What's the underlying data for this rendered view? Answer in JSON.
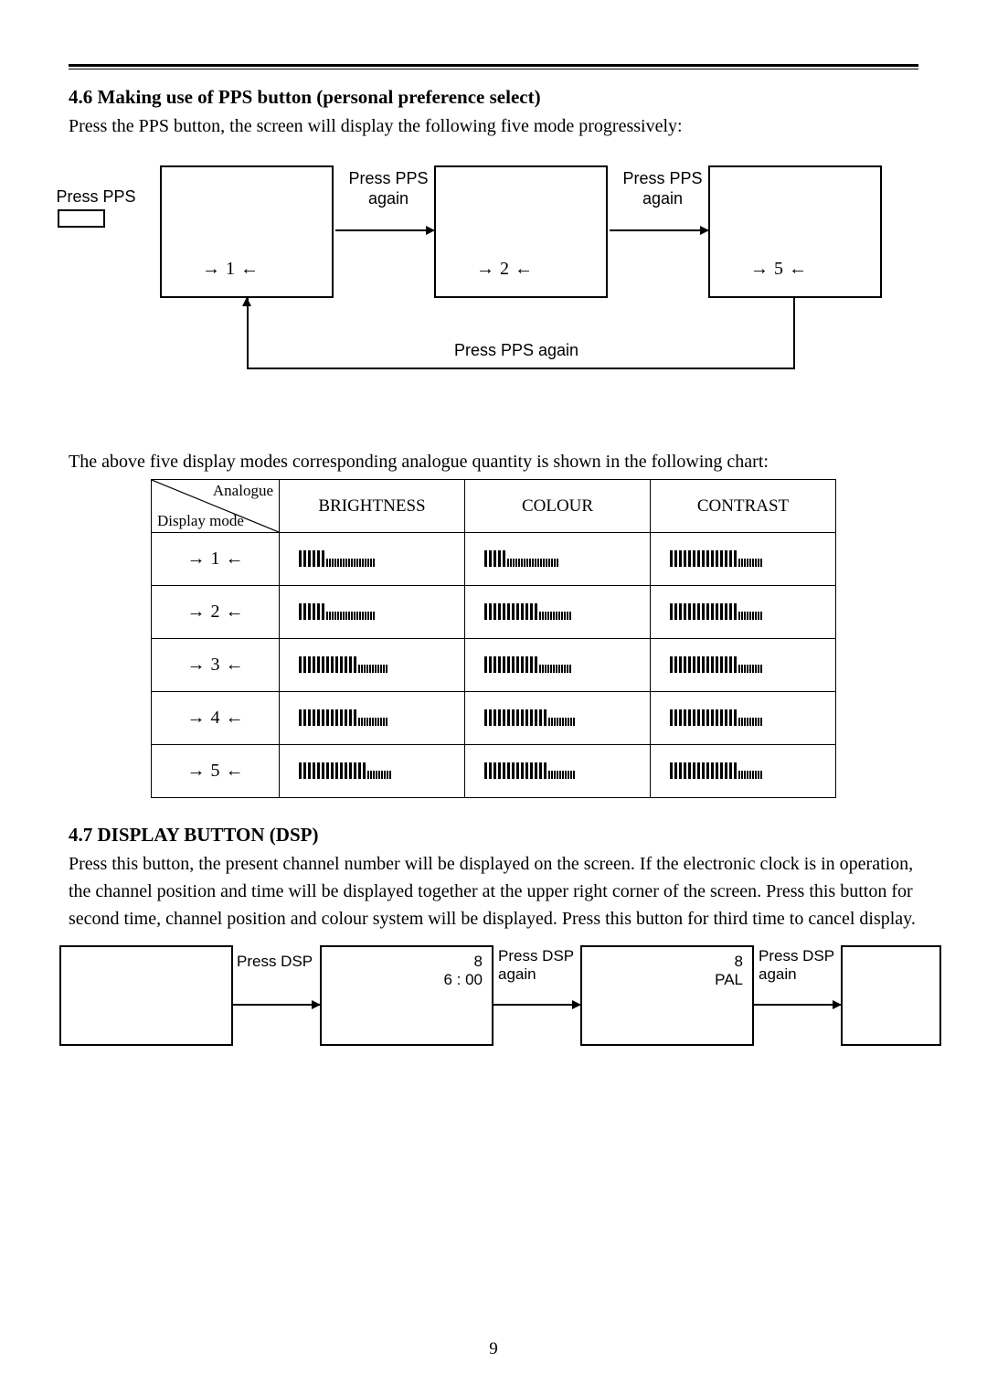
{
  "section46": {
    "heading": "4.6 Making use of PPS button (personal preference select)",
    "intro": "Press the PPS button, the screen will display the following five mode progressively:"
  },
  "pps": {
    "press_first": "Press PPS",
    "press_again": "Press PPS\nagain",
    "press_again_bottom": "Press PPS again",
    "mode1": "1",
    "mode2": "2",
    "mode5": "5"
  },
  "chart_caption": "The above five display modes corresponding analogue quantity is shown in the following chart:",
  "chart_data": {
    "type": "table",
    "corner_top": "Analogue",
    "corner_bottom": "Display mode",
    "columns": [
      "BRIGHTNESS",
      "COLOUR",
      "CONTRAST"
    ],
    "rows": [
      {
        "mode": "1",
        "brightness": 6,
        "colour": 5,
        "contrast": 15
      },
      {
        "mode": "2",
        "brightness": 6,
        "colour": 12,
        "contrast": 15
      },
      {
        "mode": "3",
        "brightness": 13,
        "colour": 12,
        "contrast": 15
      },
      {
        "mode": "4",
        "brightness": 13,
        "colour": 14,
        "contrast": 15
      },
      {
        "mode": "5",
        "brightness": 15,
        "colour": 14,
        "contrast": 15
      }
    ],
    "bar_max": 24
  },
  "section47": {
    "heading": "4.7 DISPLAY BUTTON (DSP)",
    "body": "Press this button, the present channel number will be displayed on the screen. If the electronic clock is in operation, the channel position and time will be displayed together at the upper right corner of the screen. Press this button for second time, channel position and colour system will be displayed. Press this button for third time to cancel display."
  },
  "dsp": {
    "press": "Press DSP",
    "press_again": "Press DSP\nagain",
    "screen1_line1": "8",
    "screen1_line2": "6 : 00",
    "screen2_line1": "8",
    "screen2_line2": "PAL"
  },
  "page_number": "9"
}
